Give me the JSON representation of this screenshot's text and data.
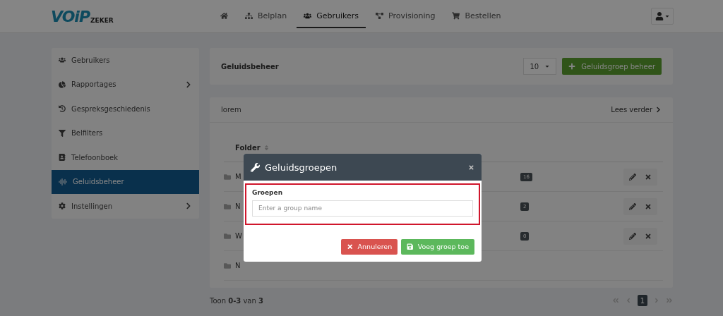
{
  "logo": {
    "main": "VOiP",
    "sub": "ZEKER"
  },
  "nav": [
    {
      "kind": "home",
      "selected": false
    },
    {
      "kind": "sitemap",
      "label": "Belplan",
      "selected": false
    },
    {
      "kind": "users",
      "label": "Gebruikers",
      "selected": true
    },
    {
      "kind": "network",
      "label": "Provisioning",
      "selected": false
    },
    {
      "kind": "cart",
      "label": "Bestellen",
      "selected": false
    }
  ],
  "sidebar": {
    "items": [
      {
        "kind": "users",
        "label": "Gebruikers",
        "submenu": false,
        "selected": false
      },
      {
        "kind": "pie",
        "label": "Rapportages",
        "submenu": true,
        "selected": false
      },
      {
        "kind": "history",
        "label": "Gespreksgeschiedenis",
        "submenu": false,
        "selected": false
      },
      {
        "kind": "filter",
        "label": "Belfilters",
        "submenu": false,
        "selected": false
      },
      {
        "kind": "book",
        "label": "Telefoonboek",
        "submenu": false,
        "selected": false
      },
      {
        "kind": "wave",
        "label": "Geluidsbeheer",
        "submenu": false,
        "selected": true
      },
      {
        "kind": "cog",
        "label": "Instellingen",
        "submenu": true,
        "selected": false
      }
    ]
  },
  "header_card": {
    "title": "Geluidsbeheer",
    "page_size": "10",
    "add_button": "Geluidsgroep beheer"
  },
  "list_card": {
    "title": "lorem",
    "more_link": "Lees verder",
    "table": {
      "columns": [
        "Folder"
      ],
      "rows": [
        {
          "name": "M",
          "count": "16",
          "actions": true
        },
        {
          "name": "N",
          "count": "2",
          "actions": true
        },
        {
          "name": "W",
          "count": "0",
          "actions": true
        },
        {
          "name": "N",
          "actions": false
        }
      ]
    }
  },
  "footer": {
    "summary": "Toon **0-3** van **3**",
    "pages": [
      {
        "label": "1",
        "selected": true
      }
    ]
  },
  "modal": {
    "title": "Geluidsgroepen",
    "field_label": "Groepen",
    "placeholder": "Enter a group name",
    "invalid": true,
    "cancel": "Annuleren",
    "submit": "Voeg groep toe"
  }
}
